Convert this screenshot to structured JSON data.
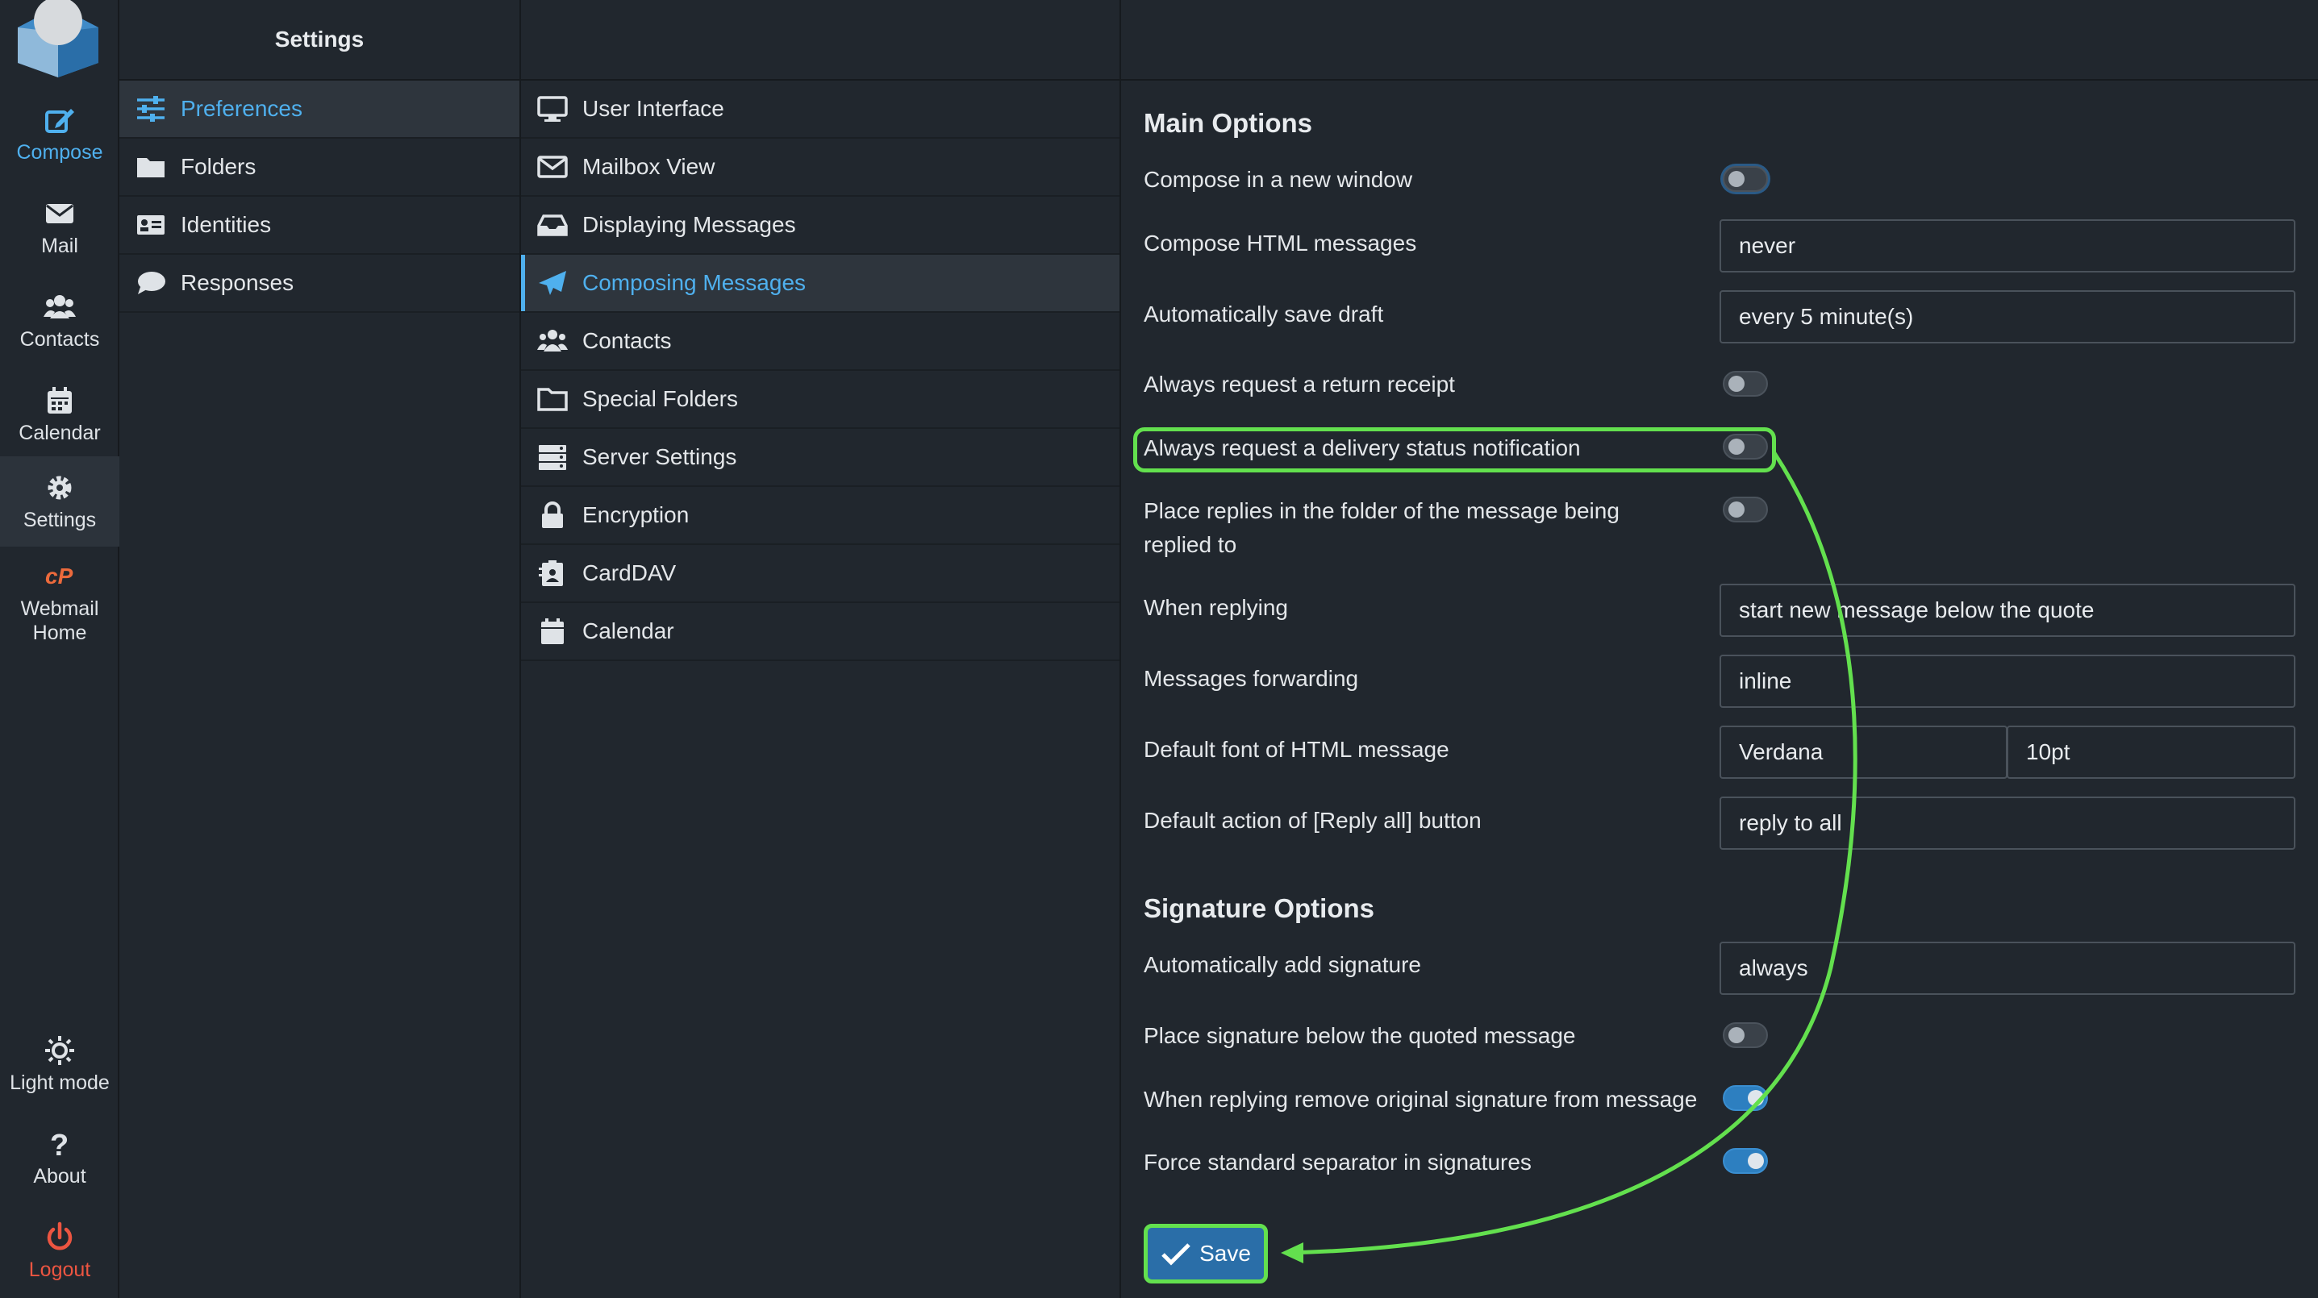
{
  "nav": {
    "items": [
      {
        "label": "Compose",
        "icon": "compose-icon"
      },
      {
        "label": "Mail",
        "icon": "mail-icon"
      },
      {
        "label": "Contacts",
        "icon": "contacts-icon"
      },
      {
        "label": "Calendar",
        "icon": "calendar-icon"
      },
      {
        "label": "Settings",
        "icon": "gear-icon"
      },
      {
        "label": "Webmail",
        "label2": "Home",
        "icon": "cpanel-icon"
      }
    ],
    "bottom": [
      {
        "label": "Light mode",
        "icon": "sun-icon"
      },
      {
        "label": "About",
        "icon": "question-icon"
      },
      {
        "label": "Logout",
        "icon": "power-icon"
      }
    ]
  },
  "settings": {
    "title": "Settings",
    "items": [
      {
        "label": "Preferences",
        "icon": "sliders-icon"
      },
      {
        "label": "Folders",
        "icon": "folder-icon"
      },
      {
        "label": "Identities",
        "icon": "id-card-icon"
      },
      {
        "label": "Responses",
        "icon": "comment-icon"
      }
    ]
  },
  "sections": {
    "items": [
      {
        "label": "User Interface",
        "icon": "monitor-icon"
      },
      {
        "label": "Mailbox View",
        "icon": "envelope-icon"
      },
      {
        "label": "Displaying Messages",
        "icon": "inbox-icon"
      },
      {
        "label": "Composing Messages",
        "icon": "paper-plane-icon"
      },
      {
        "label": "Contacts",
        "icon": "users-icon"
      },
      {
        "label": "Special Folders",
        "icon": "folder-outline-icon"
      },
      {
        "label": "Server Settings",
        "icon": "server-icon"
      },
      {
        "label": "Encryption",
        "icon": "lock-icon"
      },
      {
        "label": "CardDAV",
        "icon": "address-card-icon"
      },
      {
        "label": "Calendar",
        "icon": "calendar-icon"
      }
    ]
  },
  "main": {
    "main_options_title": "Main Options",
    "compose_new_window": "Compose in a new window",
    "compose_html": "Compose HTML messages",
    "compose_html_value": "never",
    "auto_save_draft": "Automatically save draft",
    "auto_save_draft_value": "every 5 minute(s)",
    "return_receipt": "Always request a return receipt",
    "dsn": "Always request a delivery status notification",
    "place_replies": "Place replies in the folder of the message being replied to",
    "when_replying": "When replying",
    "when_replying_value": "start new message below the quote",
    "forwarding": "Messages forwarding",
    "forwarding_value": "inline",
    "default_font": "Default font of HTML message",
    "default_font_value": "Verdana",
    "default_font_size": "10pt",
    "reply_all": "Default action of [Reply all] button",
    "reply_all_value": "reply to all",
    "signature_title": "Signature Options",
    "auto_signature": "Automatically add signature",
    "auto_signature_value": "always",
    "sig_below": "Place signature below the quoted message",
    "sig_remove": "When replying remove original signature from message",
    "sig_separator": "Force standard separator in signatures",
    "save_label": "Save"
  },
  "colors": {
    "accent": "#4fb0ee",
    "highlight": "#63e04e",
    "logout": "#ec5541"
  }
}
